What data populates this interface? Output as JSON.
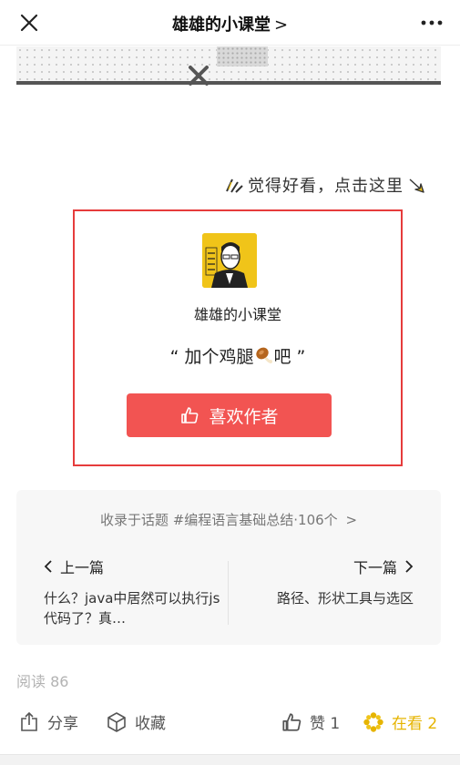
{
  "navbar": {
    "title": "雄雄的小课堂",
    "title_chevron": ">",
    "close_icon": "close-icon",
    "more_icon": "more-icon"
  },
  "hint": {
    "text": "觉得好看，点击这里"
  },
  "reward": {
    "author_name": "雄雄的小课堂",
    "quote_open": "“",
    "quote_text": " 加个鸡腿",
    "quote_suffix": "吧 ",
    "quote_close": "”",
    "button_label": "喜欢作者",
    "button_color": "#f25452",
    "border_color": "#e63c3c"
  },
  "topic": {
    "text": "收录于话题 #编程语言基础总结·106个",
    "chevron": ">"
  },
  "prev": {
    "label": "上一篇",
    "title": "什么？java中居然可以执行js代码了？真…"
  },
  "next": {
    "label": "下一篇",
    "title": "路径、形状工具与选区"
  },
  "stats": {
    "read_label": "阅读 86"
  },
  "toolbar": {
    "share_label": "分享",
    "favorite_label": "收藏",
    "like_label": "赞 1",
    "watching_label": "在看 2",
    "watching_color": "#e6b400"
  }
}
